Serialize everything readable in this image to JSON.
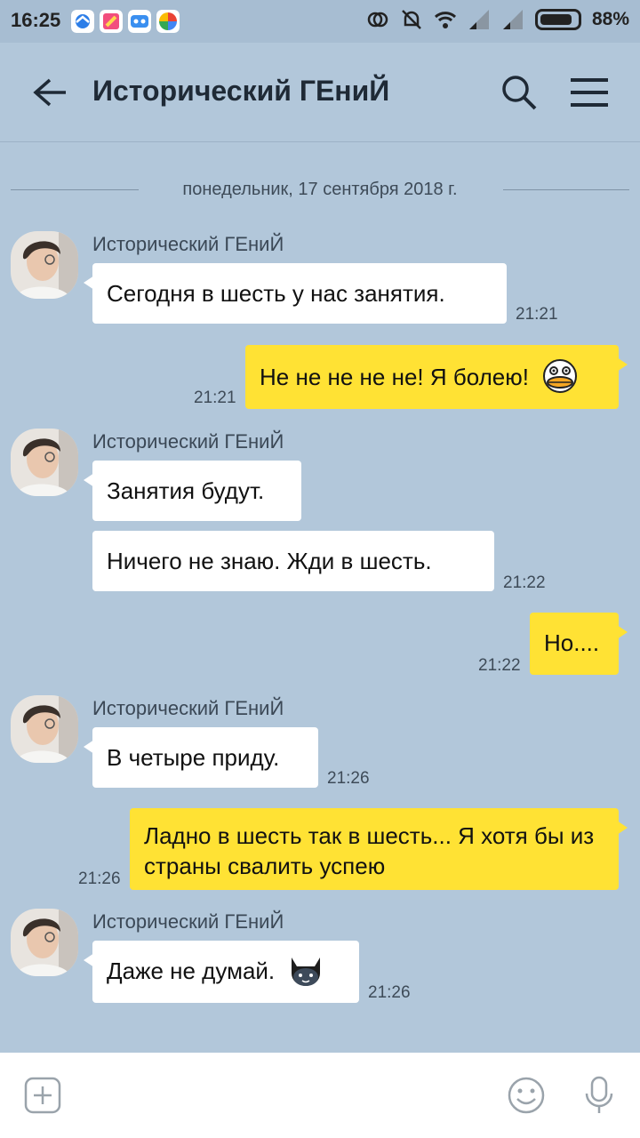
{
  "status_bar": {
    "time": "16:25",
    "battery": "88%",
    "icons": [
      "browser-app-icon",
      "kite-app-icon",
      "game-app-icon",
      "photos-app-icon",
      "sync-icon",
      "bell-off-icon",
      "wifi-icon",
      "signal-icon",
      "signal-icon",
      "battery-icon"
    ]
  },
  "header": {
    "title": "Исторический ГЕниЙ",
    "back_icon": "arrow-left-icon",
    "search_icon": "search-icon",
    "menu_icon": "hamburger-menu-icon"
  },
  "date_divider": "понедельник, 17 сентября 2018 г.",
  "messages": [
    {
      "sender": "Исторический ГЕниЙ",
      "text": "Сегодня в шесть у нас занятия.",
      "time": "21:21",
      "direction": "in"
    },
    {
      "text": "Не не не не не! Я болею!",
      "time": "21:21",
      "direction": "out",
      "emoji": "duck-emoji"
    },
    {
      "sender": "Исторический ГЕниЙ",
      "text": "Занятия будут.",
      "direction": "in"
    },
    {
      "text": "Ничего не знаю. Жди в шесть.",
      "time": "21:22",
      "direction": "in"
    },
    {
      "text": "Но....",
      "time": "21:22",
      "direction": "out"
    },
    {
      "sender": "Исторический ГЕниЙ",
      "text": "В четыре приду.",
      "time": "21:26",
      "direction": "in"
    },
    {
      "text": "Ладно в шесть так в шесть... Я хотя бы из страны свалить успею",
      "time": "21:26",
      "direction": "out"
    },
    {
      "sender": "Исторический ГЕниЙ",
      "text": "Даже не думай.",
      "time": "21:26",
      "direction": "in",
      "emoji": "cat-emoji"
    }
  ],
  "input_bar": {
    "add_icon": "plus-icon",
    "emoji_icon": "smiley-icon",
    "mic_icon": "microphone-icon"
  },
  "colors": {
    "background": "#b2c7da",
    "incoming_bubble": "#ffffff",
    "outgoing_bubble": "#ffe234",
    "text": "#111111"
  }
}
